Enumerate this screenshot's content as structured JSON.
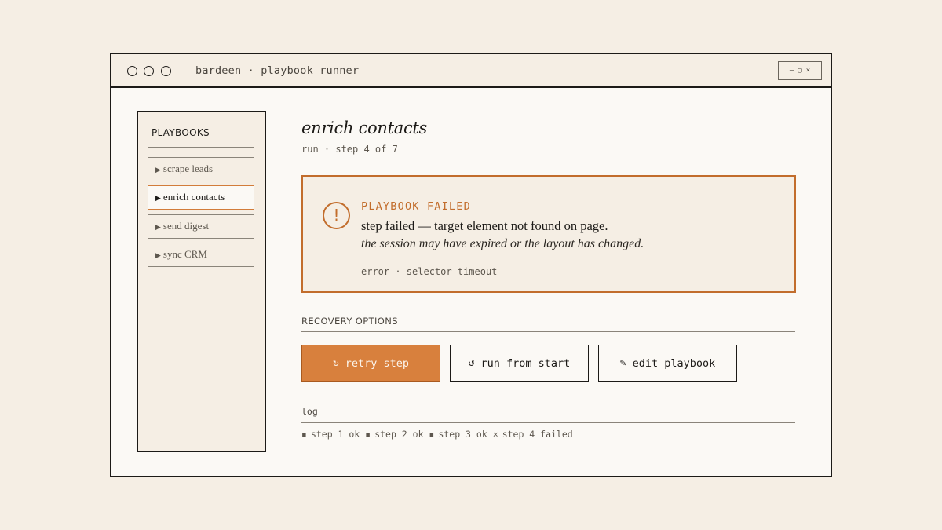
{
  "colors": {
    "background": "#f5eee4",
    "accent": "#d8803d",
    "error": "#c26d2c",
    "ink": "#1c1a17"
  },
  "window": {
    "title": "bardeen · playbook runner",
    "controls": {
      "minimize": "—",
      "maximize": "▢",
      "close": "×"
    }
  },
  "sidebar": {
    "heading": "PLAYBOOKS",
    "items": [
      {
        "marker": "▶",
        "label": "scrape leads",
        "active": false
      },
      {
        "marker": "▶",
        "label": "enrich contacts",
        "active": true
      },
      {
        "marker": "▶",
        "label": "send digest",
        "active": false
      },
      {
        "marker": "▶",
        "label": "sync CRM",
        "active": false
      }
    ]
  },
  "main": {
    "title": "enrich contacts",
    "subtitle": "run · step 4 of 7"
  },
  "alert": {
    "icon": "exclamation-icon",
    "icon_glyph": "!",
    "heading": "PLAYBOOK FAILED",
    "message": "step failed — target element not found on page.",
    "detail": "the session may have expired or the layout has changed.",
    "code": "error · selector timeout"
  },
  "recovery": {
    "label": "RECOVERY OPTIONS",
    "buttons": [
      {
        "icon": "↻",
        "label": "retry step"
      },
      {
        "icon": "↺",
        "label": "run from start"
      },
      {
        "icon": "✎",
        "label": "edit playbook"
      }
    ]
  },
  "log": {
    "label": "log",
    "entries": [
      {
        "mark": "▪",
        "text": "step 1 ok"
      },
      {
        "mark": "▪",
        "text": "step 2 ok"
      },
      {
        "mark": "▪",
        "text": "step 3 ok"
      },
      {
        "mark": "×",
        "text": "step 4 failed"
      }
    ]
  }
}
